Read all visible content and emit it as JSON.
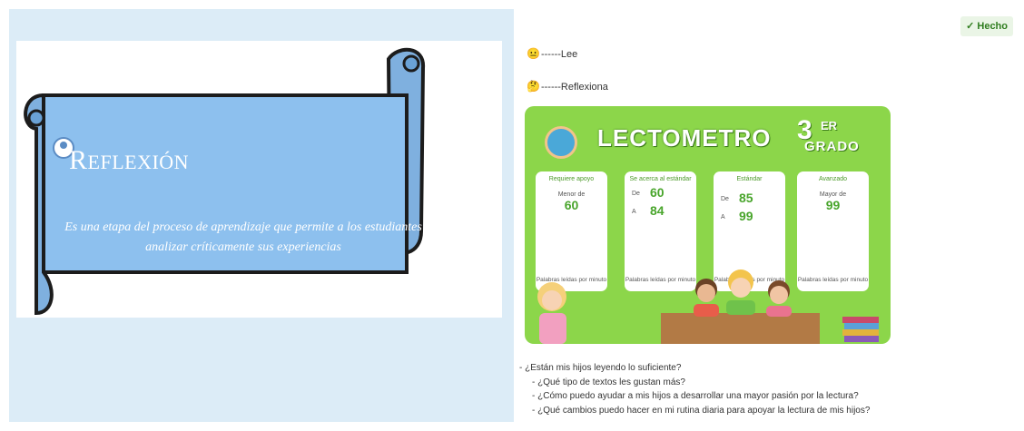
{
  "left": {
    "title_initial": "R",
    "title_rest": "EFLEXIÓN",
    "body": "Es una etapa del proceso de aprendizaje que permite a los estudiantes analizar críticamente sus experiencias"
  },
  "right": {
    "done_button": "✓ Hecho",
    "key_read_icon": "😐",
    "key_read": "------Lee",
    "key_reflect_icon": "🤔",
    "key_reflect": "------Reflexiona",
    "lectometro": {
      "title": "LECTOMETRO",
      "grade_num": "3",
      "grade_suffix": "ER",
      "grade_word": "GRADO",
      "cards": [
        {
          "title": "Requiere apoyo",
          "row": "Menor de",
          "value": "60",
          "foot": "Palabras leídas por minuto"
        },
        {
          "title": "Se acerca al estándar",
          "from_label": "De",
          "from": "60",
          "to_label": "A",
          "to": "84",
          "foot": "Palabras leídas por minuto"
        },
        {
          "title": "Estándar",
          "from_label": "De",
          "from": "85",
          "to_label": "A",
          "to": "99",
          "foot": "Palabras leídas por minuto"
        },
        {
          "title": "Avanzado",
          "row": "Mayor de",
          "value": "99",
          "foot": "Palabras leídas por minuto"
        }
      ]
    },
    "questions": [
      "- ¿Están mis hijos leyendo lo suficiente?",
      "- ¿Qué tipo de textos les gustan más?",
      "- ¿Cómo puedo ayudar a mis hijos a desarrollar una mayor pasión por la lectura?",
      "- ¿Qué cambios puedo hacer en mi rutina diaria para apoyar la lectura de mis hijos?"
    ]
  },
  "colors": {
    "left_bg": "#dcecf7",
    "scroll_fill": "#8dc0ee",
    "lecto_green": "#8cd64a",
    "done_green": "#2f7d1f"
  }
}
